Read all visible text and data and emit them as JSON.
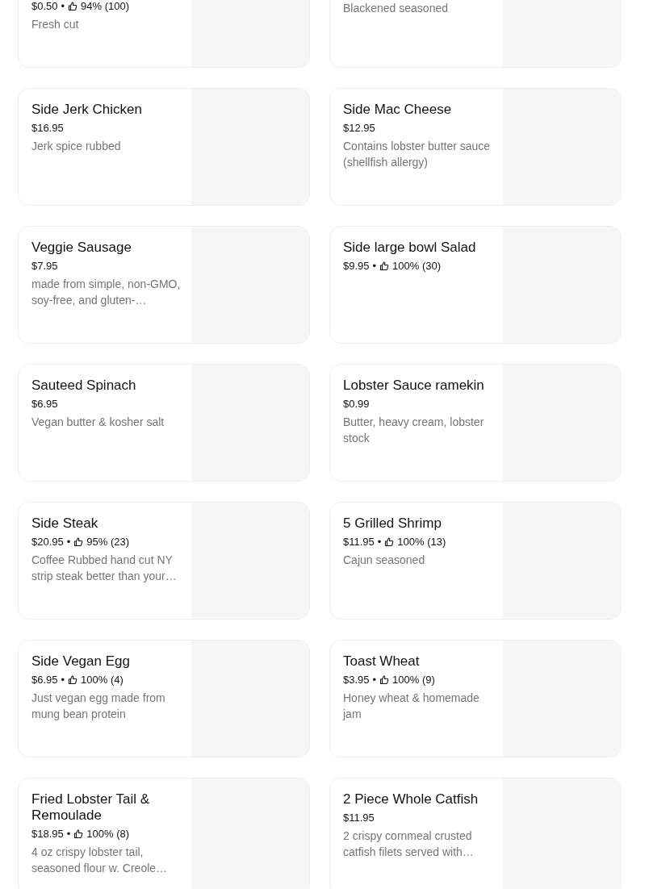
{
  "rows": [
    [
      {
        "title_hidden": true,
        "price": "$0.50",
        "separator": "•",
        "rating": "94% (100)",
        "description": "Fresh cut"
      },
      {
        "title_hidden": true,
        "description": "Blackened seasoned"
      }
    ],
    [
      {
        "title": "Side Jerk Chicken",
        "price": "$16.95",
        "description": "Jerk spice rubbed"
      },
      {
        "title": "Side Mac Cheese",
        "price": "$12.95",
        "description": "Contains lobster butter sauce (shellfish allergy)"
      }
    ],
    [
      {
        "title": "Veggie Sausage",
        "price": "$7.95",
        "description": "made from simple, non-GMO, soy-free, and gluten-…"
      },
      {
        "title": "Side large bowl Salad",
        "price": "$9.95",
        "separator": "•",
        "rating": "100% (30)"
      }
    ],
    [
      {
        "title": "Sauteed Spinach",
        "price": "$6.95",
        "description": "Vegan butter & kosher salt"
      },
      {
        "title": "Lobster Sauce ramekin",
        "price": "$0.99",
        "description": "Butter, heavy cream, lobster stock"
      }
    ],
    [
      {
        "title": "Side Steak",
        "price": "$20.95",
        "separator": "•",
        "rating": "95% (23)",
        "description": "Coffee Rubbed hand cut NY strip steak better than your…"
      },
      {
        "title": "5 Grilled Shrimp",
        "price": "$11.95",
        "separator": "•",
        "rating": "100% (13)",
        "description": "Cajun seasoned"
      }
    ],
    [
      {
        "title": "Side Vegan Egg",
        "price": "$6.95",
        "separator": "•",
        "rating": "100% (4)",
        "description": "Just vegan egg made from mung bean protein"
      },
      {
        "title": "Toast Wheat",
        "price": "$3.95",
        "separator": "•",
        "rating": "100% (9)",
        "description": "Honey wheat & homemade jam"
      }
    ],
    [
      {
        "title": "Fried Lobster Tail & Remoulade",
        "price": "$18.95",
        "separator": "•",
        "rating": "100% (8)",
        "description": "4 oz crispy lobster tail, seasoned flour w. Creole…"
      },
      {
        "title": "2 Piece Whole Catfish",
        "price": "$11.95",
        "description": "2 crispy cornmeal crusted catfish filets served with…"
      }
    ]
  ]
}
